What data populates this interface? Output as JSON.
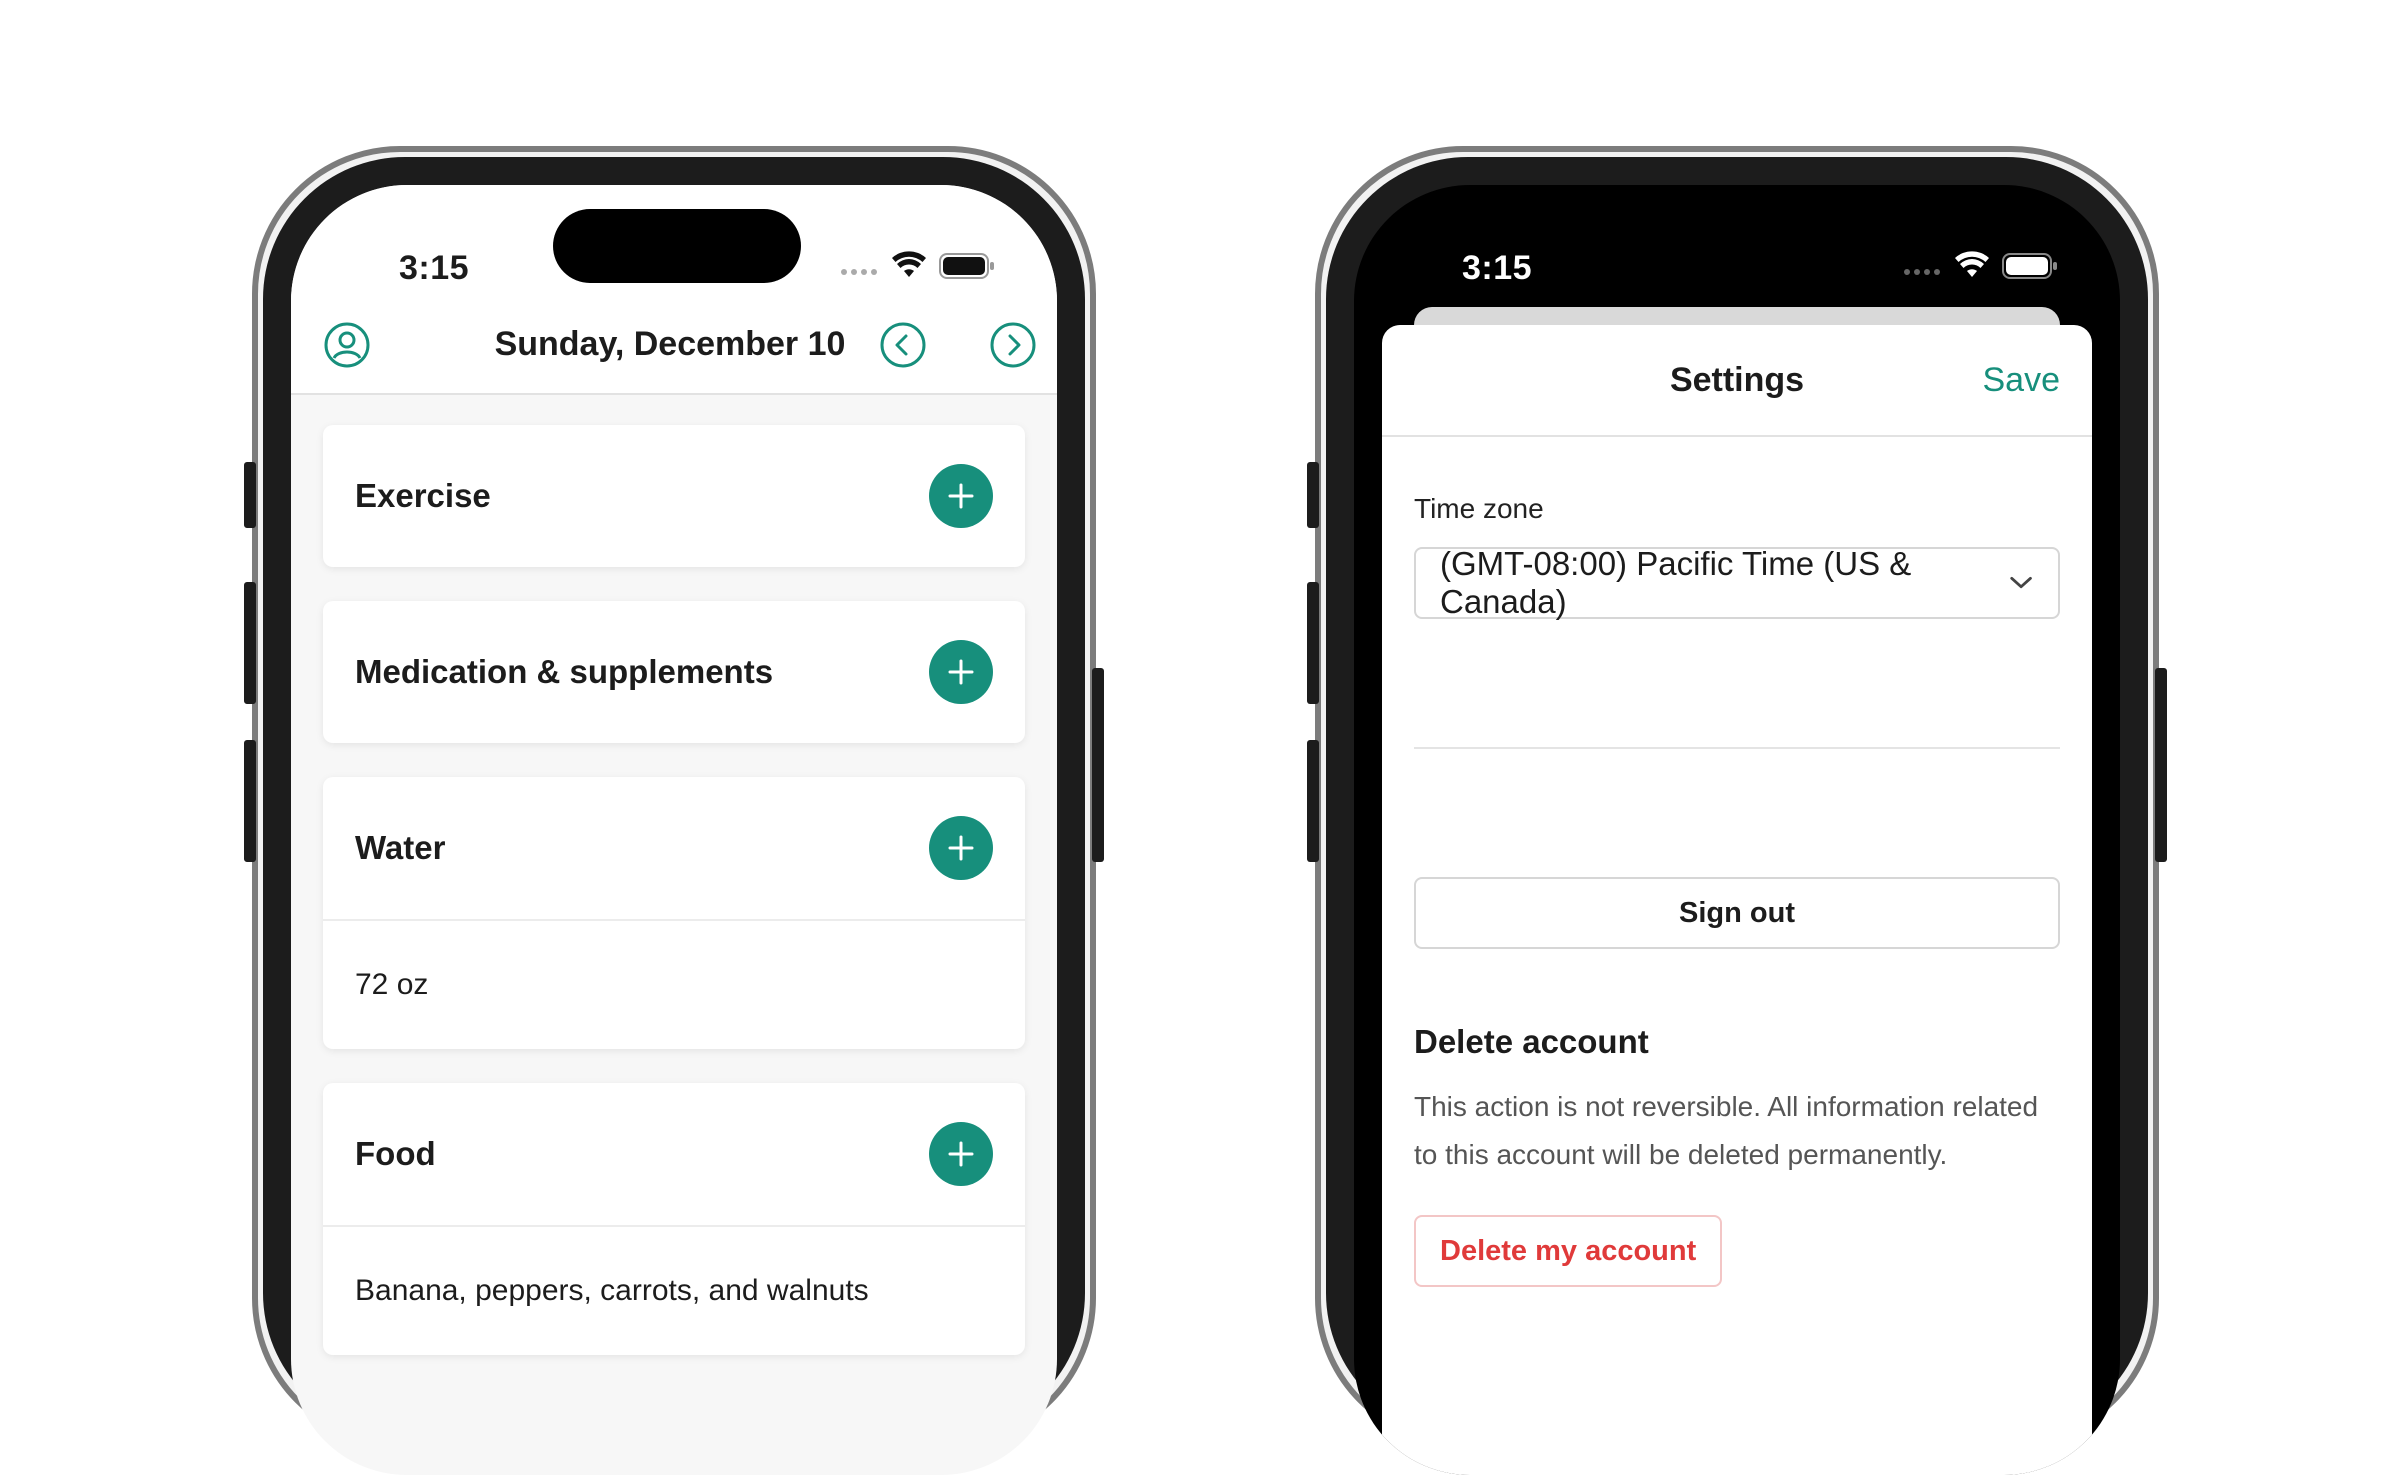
{
  "colors": {
    "accent": "#178f7c",
    "danger": "#e03a3a",
    "danger_border": "#f3c6c6"
  },
  "left_phone": {
    "status_time": "3:15",
    "header": {
      "date": "Sunday, December 10",
      "icons": [
        "user-circle-icon",
        "chevron-left-icon",
        "chevron-right-icon"
      ]
    },
    "cards": [
      {
        "title": "Exercise"
      },
      {
        "title": "Medication & supplements"
      },
      {
        "title": "Water",
        "value": "72 oz"
      },
      {
        "title": "Food",
        "value": "Banana, peppers, carrots, and walnuts"
      }
    ]
  },
  "right_phone": {
    "status_time": "3:15",
    "sheet": {
      "title": "Settings",
      "save_label": "Save",
      "time_zone_label": "Time zone",
      "time_zone_value": "(GMT-08:00) Pacific Time (US & Canada)",
      "sign_out_label": "Sign out",
      "delete_heading": "Delete account",
      "delete_description": "This action is not reversible. All information related to this account will be deleted permanently.",
      "delete_button_label": "Delete my account"
    }
  }
}
